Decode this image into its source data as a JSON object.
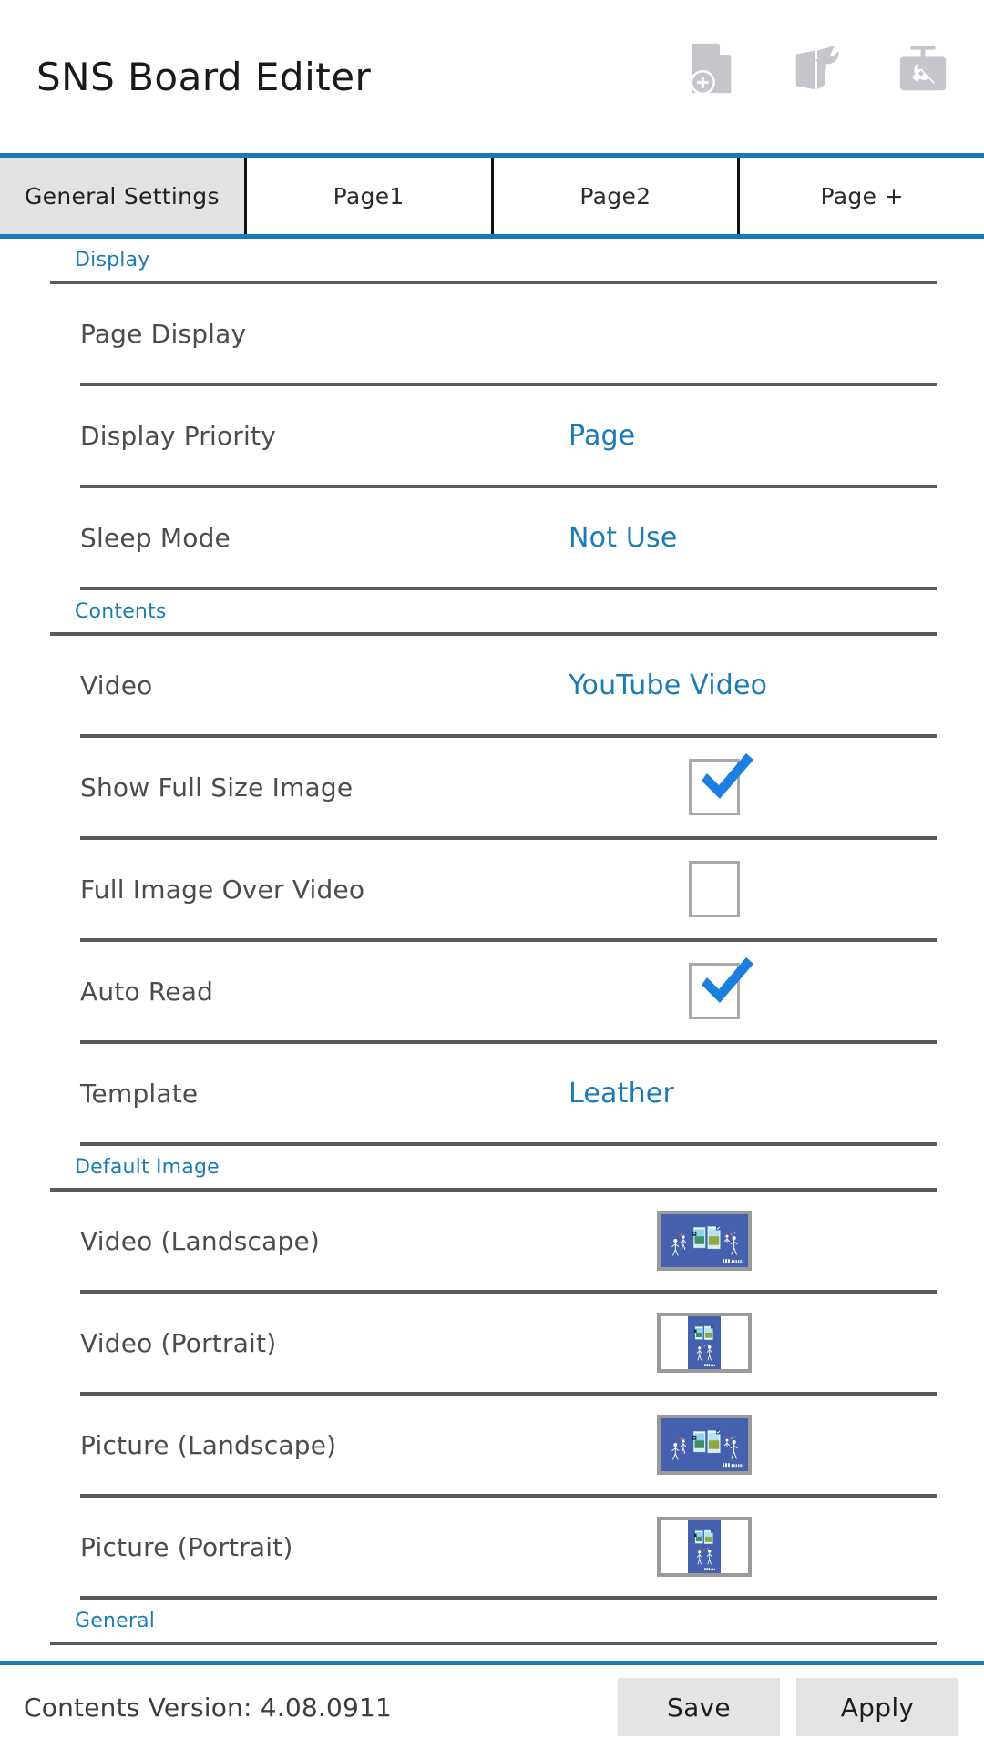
{
  "header": {
    "title": "SNS Board Editer",
    "actions": [
      {
        "name": "new-page-icon",
        "label": "New Page"
      },
      {
        "name": "import-book-icon",
        "label": "Import"
      },
      {
        "name": "toolbox-icon",
        "label": "Tools"
      }
    ]
  },
  "tabs": [
    {
      "label": "General Settings",
      "active": true
    },
    {
      "label": "Page1",
      "active": false
    },
    {
      "label": "Page2",
      "active": false
    },
    {
      "label": "Page +",
      "active": false
    }
  ],
  "sections": [
    {
      "title": "Display",
      "rows": [
        {
          "label": "Page Display",
          "type": "value",
          "value": ""
        },
        {
          "label": "Display Priority",
          "type": "value",
          "value": "Page"
        },
        {
          "label": "Sleep Mode",
          "type": "value",
          "value": "Not Use"
        }
      ]
    },
    {
      "title": "Contents",
      "rows": [
        {
          "label": "Video",
          "type": "value",
          "value": "YouTube Video"
        },
        {
          "label": "Show Full Size Image",
          "type": "checkbox",
          "checked": true
        },
        {
          "label": "Full Image Over Video",
          "type": "checkbox",
          "checked": false
        },
        {
          "label": "Auto Read",
          "type": "checkbox",
          "checked": true
        },
        {
          "label": "Template",
          "type": "value",
          "value": "Leather"
        }
      ]
    },
    {
      "title": "Default Image",
      "rows": [
        {
          "label": "Video (Landscape)",
          "type": "thumb",
          "orientation": "landscape"
        },
        {
          "label": "Video (Portrait)",
          "type": "thumb",
          "orientation": "portrait"
        },
        {
          "label": "Picture (Landscape)",
          "type": "thumb",
          "orientation": "landscape"
        },
        {
          "label": "Picture (Portrait)",
          "type": "thumb",
          "orientation": "portrait"
        }
      ]
    },
    {
      "title": "General",
      "rows": []
    }
  ],
  "footer": {
    "version_label": "Contents Version: 4.08.0911",
    "save_label": "Save",
    "apply_label": "Apply"
  },
  "colors": {
    "accent": "#1b7cb5",
    "value_text": "#1b7cb5",
    "label_text": "#4c4c4c",
    "rule": "#5a5a5a",
    "tab_active_bg": "#e2e2e2",
    "button_bg": "#e4e4e4",
    "icon_gray": "#c4c6cc",
    "poster_blue": "#4560ad",
    "check_blue": "#1b7fe0"
  }
}
